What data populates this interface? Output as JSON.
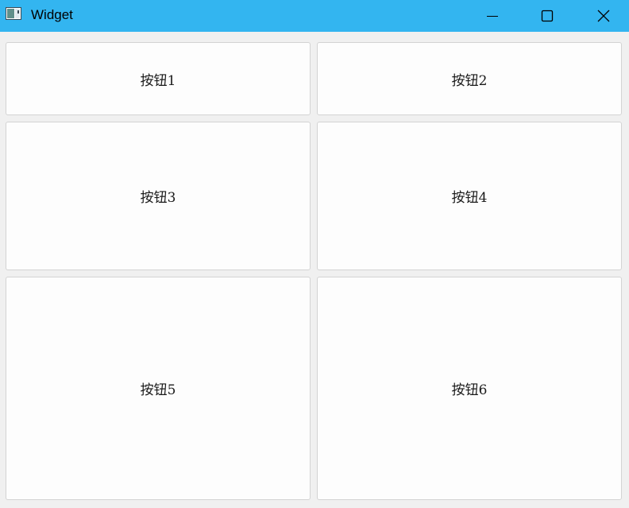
{
  "window": {
    "title": "Widget",
    "icon": "window-app-icon",
    "controls": {
      "minimize_icon": "minimize-icon",
      "maximize_icon": "maximize-icon",
      "close_icon": "close-icon"
    },
    "titlebar_color": "#33b5f0",
    "background_color": "#f0f0f0"
  },
  "buttons": [
    {
      "label": "按钮1"
    },
    {
      "label": "按钮2"
    },
    {
      "label": "按钮3"
    },
    {
      "label": "按钮4"
    },
    {
      "label": "按钮5"
    },
    {
      "label": "按钮6"
    }
  ]
}
